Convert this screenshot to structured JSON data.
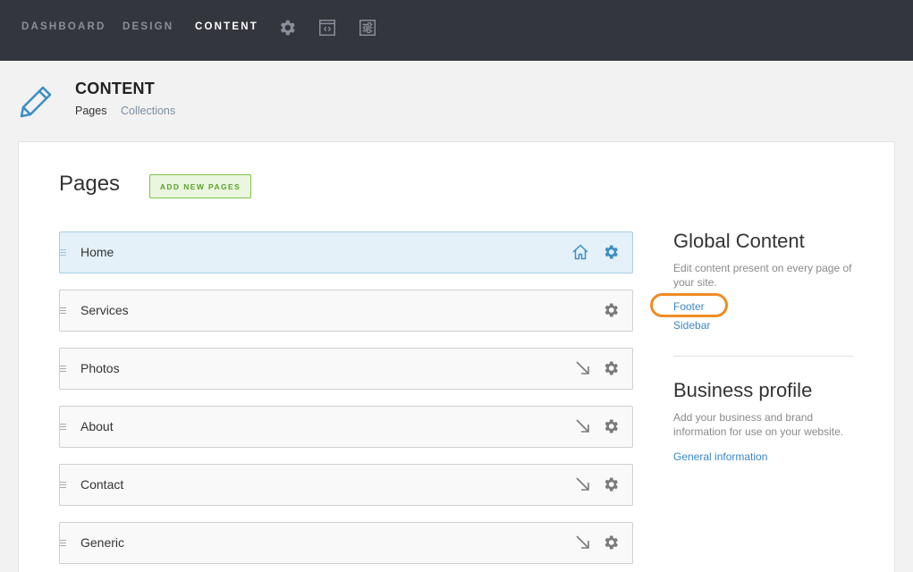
{
  "topnav": {
    "dashboard": "DASHBOARD",
    "design": "DESIGN",
    "content": "CONTENT",
    "icons": [
      "gear-icon",
      "code-window-icon",
      "settings-panel-icon"
    ]
  },
  "header": {
    "title": "CONTENT",
    "subnav": {
      "pages": "Pages",
      "collections": "Collections"
    }
  },
  "pages": {
    "title": "Pages",
    "add_button": "ADD NEW PAGES",
    "rows": [
      {
        "label": "Home",
        "icons": [
          "home-icon",
          "gear-icon"
        ],
        "selected": true
      },
      {
        "label": "Services",
        "icons": [
          "gear-icon"
        ]
      },
      {
        "label": "Photos",
        "icons": [
          "arrow-down-right-icon",
          "gear-icon"
        ]
      },
      {
        "label": "About",
        "icons": [
          "arrow-down-right-icon",
          "gear-icon"
        ]
      },
      {
        "label": "Contact",
        "icons": [
          "arrow-down-right-icon",
          "gear-icon"
        ]
      },
      {
        "label": "Generic",
        "icons": [
          "arrow-down-right-icon",
          "gear-icon"
        ]
      }
    ]
  },
  "global_content": {
    "title": "Global Content",
    "description": "Edit content present on every page of your site.",
    "links": {
      "footer": "Footer",
      "sidebar": "Sidebar"
    }
  },
  "business_profile": {
    "title": "Business profile",
    "description": "Add your business and brand information for use on your website.",
    "link": "General information"
  },
  "colors": {
    "topbar": "#33363d",
    "accent_blue": "#3b87c6",
    "add_button_green": "#7ac443",
    "highlight_orange": "#f08b24",
    "selected_row": "#e4f1f8"
  }
}
